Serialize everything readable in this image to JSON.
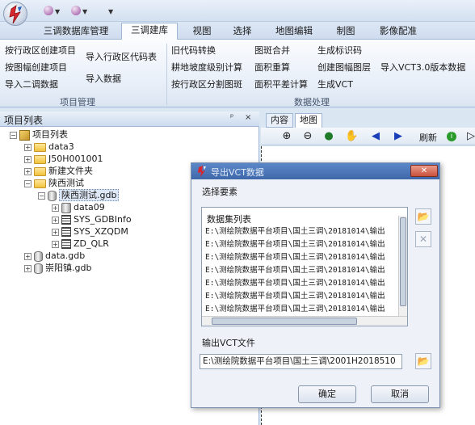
{
  "quick_access": [
    "orb-menu-1",
    "orb-menu-2"
  ],
  "tabs": [
    "三调数据库管理",
    "三调建库",
    "视图",
    "选择",
    "地图编辑",
    "制图",
    "影像配准"
  ],
  "ribbon": {
    "project": {
      "items": [
        "按行政区创建项目",
        "按图幅创建项目",
        "导入二调数据",
        "导入行政区代码表",
        "导入数据"
      ],
      "group_label": "项目管理"
    },
    "data": {
      "items": [
        "旧代码转换",
        "耕地坡度级别计算",
        "按行政区分割图斑",
        "图斑合并",
        "面积重算",
        "面积平差计算",
        "生成标识码",
        "创建图幅图层",
        "生成VCT",
        "导入VCT3.0版本数据"
      ],
      "group_label": "数据处理"
    }
  },
  "project_panel": {
    "title": "项目列表",
    "pin": "ᵖ",
    "close": "×",
    "tree": {
      "root": "项目列表",
      "items": [
        "data3",
        "J50H001001",
        "新建文件夹",
        "陕西测试",
        "陕西测试.gdb",
        "data09",
        "SYS_GDBInfo",
        "SYS_XZQDM",
        "ZD_QLR",
        "data.gdb",
        "崇阳镇.gdb"
      ]
    }
  },
  "map_view": {
    "tabs": [
      "内容",
      "地图"
    ],
    "toolbar": {
      "refresh_label": "刷新"
    }
  },
  "dialog": {
    "title": "导出VCT数据",
    "select_label": "选择要素",
    "list_header": "数据集列表",
    "list_items": [
      "E:\\测绘院数据平台项目\\国土三调\\20181014\\输出",
      "E:\\测绘院数据平台项目\\国土三调\\20181014\\输出",
      "E:\\测绘院数据平台项目\\国土三调\\20181014\\输出",
      "E:\\测绘院数据平台项目\\国土三调\\20181014\\输出",
      "E:\\测绘院数据平台项目\\国土三调\\20181014\\输出",
      "E:\\测绘院数据平台项目\\国土三调\\20181014\\输出",
      "E:\\测绘院数据平台项目\\国土三调\\20181014\\输出"
    ],
    "output_label": "输出VCT文件",
    "output_value": "E:\\测绘院数据平台项目\\国土三调\\2001H2018510",
    "ok_label": "确定",
    "cancel_label": "取消"
  }
}
